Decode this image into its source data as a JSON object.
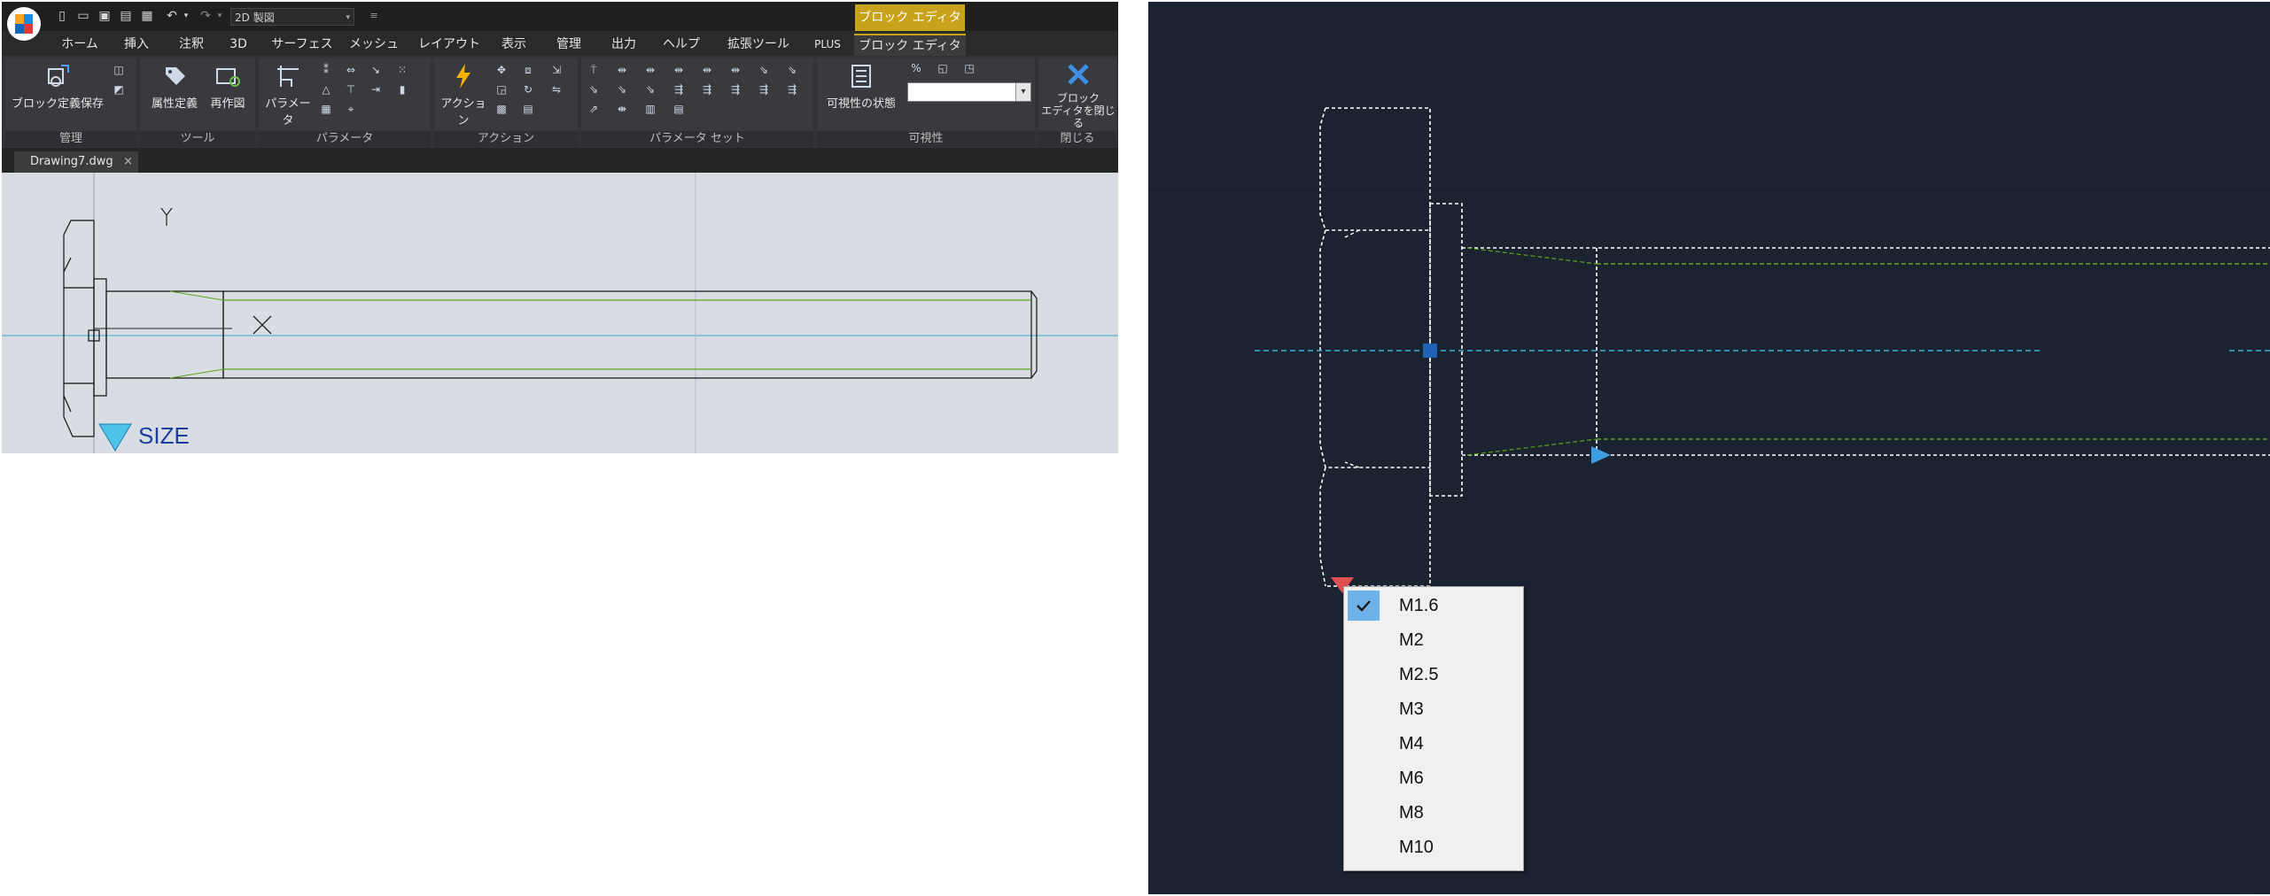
{
  "app": {
    "workspace": "2D 製図",
    "context_tab_header": "ブロック エディタ"
  },
  "ribbon_tabs": [
    {
      "label": "ホーム"
    },
    {
      "label": "挿入"
    },
    {
      "label": "注釈"
    },
    {
      "label": "3D"
    },
    {
      "label": "サーフェス"
    },
    {
      "label": "メッシュ"
    },
    {
      "label": "レイアウト"
    },
    {
      "label": "表示"
    },
    {
      "label": "管理"
    },
    {
      "label": "出力"
    },
    {
      "label": "ヘルプ"
    },
    {
      "label": "拡張ツール"
    },
    {
      "label": "PLUS"
    },
    {
      "label": "ブロック エディタ"
    }
  ],
  "panels": {
    "manage": {
      "label": "管理",
      "save_button": "ブロック定義保存"
    },
    "tools": {
      "label": "ツール",
      "attribute_button": "属性定義",
      "regen_button": "再作図"
    },
    "parameters": {
      "label": "パラメータ",
      "parameter_button": "パラメータ"
    },
    "actions": {
      "label": "アクション",
      "action_button": "アクション"
    },
    "parameter_sets": {
      "label": "パラメータ セット"
    },
    "visibility": {
      "label": "可視性",
      "visibility_state_button": "可視性の状態",
      "dropdown_value": ""
    },
    "close": {
      "label": "閉じる",
      "close_line1": "ブロック",
      "close_line2": "エディタを閉じる"
    }
  },
  "document_tab": {
    "name": "Drawing7.dwg",
    "close": "×"
  },
  "drawing": {
    "block_label": "SIZE",
    "ucs_y": "Y"
  },
  "popup_menu": {
    "items": [
      {
        "label": "M1.6",
        "checked": true
      },
      {
        "label": "M2",
        "checked": false
      },
      {
        "label": "M2.5",
        "checked": false
      },
      {
        "label": "M3",
        "checked": false
      },
      {
        "label": "M4",
        "checked": false
      },
      {
        "label": "M6",
        "checked": false
      },
      {
        "label": "M8",
        "checked": false
      },
      {
        "label": "M10",
        "checked": false
      }
    ]
  },
  "colors": {
    "accent": "#c8a21a",
    "grip": "#1e63b8",
    "green_line": "#5fa31f",
    "cyan_line": "#3ab0d8",
    "check_highlight": "#6fb2ea"
  }
}
